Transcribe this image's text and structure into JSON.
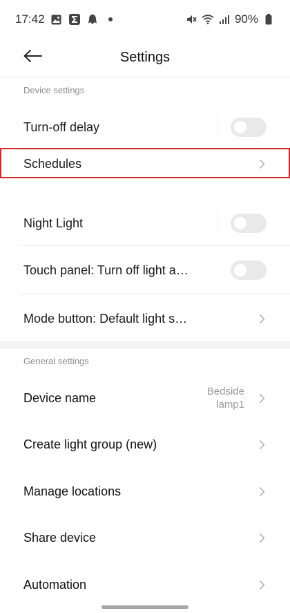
{
  "status_bar": {
    "time": "17:42",
    "battery": "90%",
    "left_icons": [
      "image-icon",
      "sigma-app-icon",
      "ghost-icon",
      "dot-icon"
    ],
    "right_icons": [
      "mute-icon",
      "wifi-icon",
      "signal-icon",
      "battery-icon"
    ]
  },
  "header": {
    "title": "Settings",
    "back_icon": "arrow-left-icon"
  },
  "device_settings": {
    "label": "Device settings",
    "items": [
      {
        "label": "Turn-off delay",
        "control": "toggle",
        "on": false
      },
      {
        "label": "Schedules",
        "control": "chevron"
      },
      {
        "label": "Night Light",
        "control": "toggle",
        "on": false
      },
      {
        "label": "Touch panel: Turn off light a…",
        "control": "toggle",
        "on": false
      },
      {
        "label": "Mode button: Default light s…",
        "control": "chevron"
      }
    ]
  },
  "general_settings": {
    "label": "General settings",
    "items": [
      {
        "label": "Device name",
        "value_line1": "Bedside",
        "value_line2": "lamp1",
        "control": "chevron"
      },
      {
        "label": "Create light group (new)",
        "control": "chevron"
      },
      {
        "label": "Manage locations",
        "control": "chevron"
      },
      {
        "label": "Share device",
        "control": "chevron"
      },
      {
        "label": "Automation",
        "control": "chevron"
      }
    ]
  },
  "colors": {
    "highlight": "#d7262e",
    "toggle_off": "#e9e9e9",
    "text_primary": "#1a1a1a",
    "text_secondary": "#8c8c8c"
  }
}
